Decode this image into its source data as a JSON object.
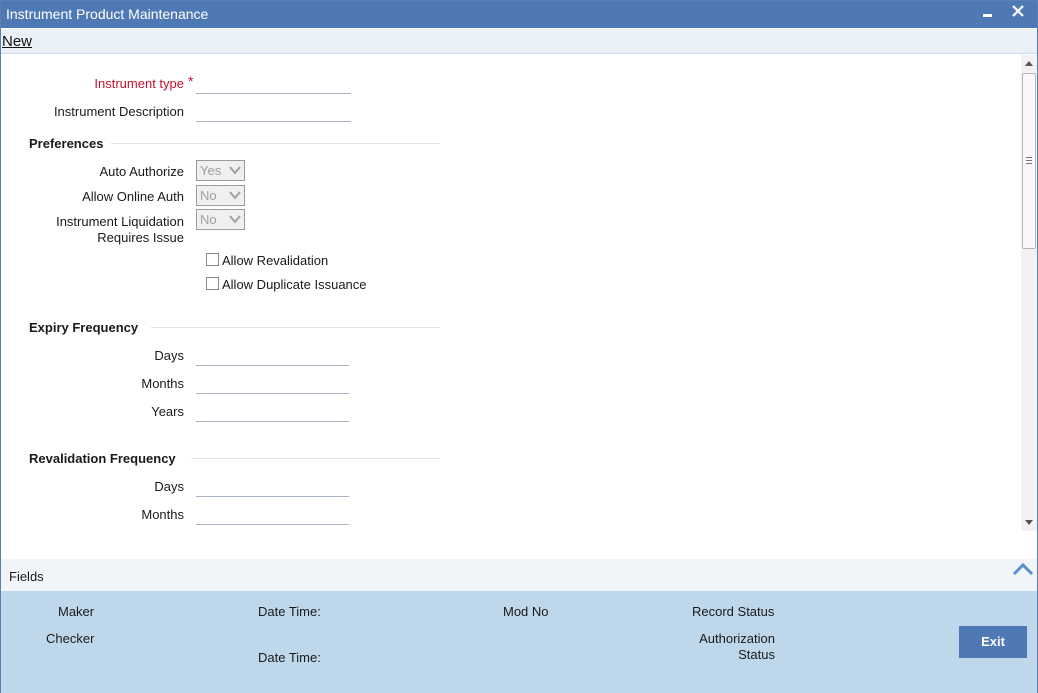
{
  "window": {
    "title": "Instrument Product Maintenance",
    "minimize_glyph": "▬",
    "close_glyph": "✕"
  },
  "menu": {
    "new_label": "New"
  },
  "form": {
    "instrument_type": {
      "label": "Instrument type",
      "required_mark": "*",
      "value": ""
    },
    "instrument_description": {
      "label": "Instrument Description",
      "value": ""
    },
    "preferences": {
      "title": "Preferences",
      "auto_authorize": {
        "label": "Auto Authorize",
        "value": "Yes"
      },
      "allow_online_auth": {
        "label": "Allow Online Auth",
        "value": "No"
      },
      "instrument_liquidation": {
        "label_line1": "Instrument Liquidation",
        "label_line2": "Requires Issue",
        "value": "No"
      },
      "allow_revalidation": {
        "label": "Allow Revalidation",
        "checked": false
      },
      "allow_duplicate_issuance": {
        "label": "Allow Duplicate Issuance",
        "checked": false
      }
    },
    "expiry_frequency": {
      "title": "Expiry Frequency",
      "days": {
        "label": "Days",
        "value": ""
      },
      "months": {
        "label": "Months",
        "value": ""
      },
      "years": {
        "label": "Years",
        "value": ""
      }
    },
    "revalidation_frequency": {
      "title": "Revalidation Frequency",
      "days": {
        "label": "Days",
        "value": ""
      },
      "months": {
        "label": "Months",
        "value": ""
      }
    }
  },
  "fields_bar": {
    "label": "Fields"
  },
  "audit": {
    "maker": "Maker",
    "checker": "Checker",
    "date_time_1": "Date Time:",
    "date_time_2": "Date Time:",
    "mod_no": "Mod No",
    "record_status": "Record Status",
    "authorization_line1": "Authorization",
    "authorization_line2": "Status",
    "exit_label": "Exit"
  },
  "colors": {
    "title_bar": "#4f79b5",
    "required": "#c8102e",
    "audit_panel": "#bed7eb",
    "exit_button": "#4f79b5"
  }
}
